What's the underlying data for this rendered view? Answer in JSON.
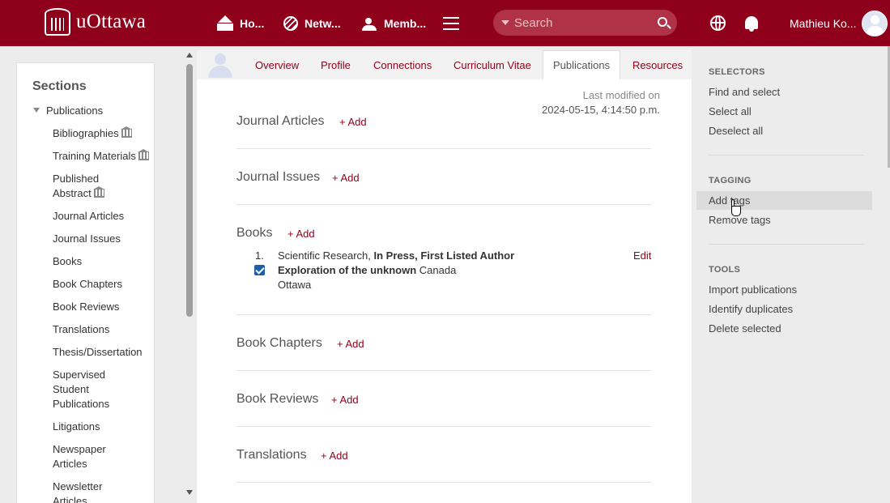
{
  "header": {
    "logo_text": "uOttawa",
    "nav": [
      {
        "label": "Ho..."
      },
      {
        "label": "Netw..."
      },
      {
        "label": "Memb..."
      }
    ],
    "search_placeholder": "Search",
    "user_name": "Mathieu Ko..."
  },
  "sidebar": {
    "title": "Sections",
    "root": "Publications",
    "items": [
      {
        "label": "Bibliographies"
      },
      {
        "label": "Training Materials"
      },
      {
        "label": "Published Abstract"
      },
      {
        "label": "Journal Articles"
      },
      {
        "label": "Journal Issues"
      },
      {
        "label": "Books"
      },
      {
        "label": "Book Chapters"
      },
      {
        "label": "Book Reviews"
      },
      {
        "label": "Translations"
      },
      {
        "label": "Thesis/Dissertation"
      },
      {
        "label": "Supervised Student Publications"
      },
      {
        "label": "Litigations"
      },
      {
        "label": "Newspaper Articles"
      },
      {
        "label": "Newsletter Articles"
      }
    ]
  },
  "tabs": [
    {
      "label": "Overview"
    },
    {
      "label": "Profile"
    },
    {
      "label": "Connections"
    },
    {
      "label": "Curriculum Vitae"
    },
    {
      "label": "Publications"
    },
    {
      "label": "Resources"
    }
  ],
  "main": {
    "last_modified_label": "Last modified on",
    "last_modified_date": "2024-05-15, 4:14:50 p.m.",
    "add_label": "+ Add",
    "sections": [
      {
        "title": "Journal Articles"
      },
      {
        "title": "Journal Issues"
      },
      {
        "title": "Books"
      },
      {
        "title": "Book Chapters"
      },
      {
        "title": "Book Reviews"
      },
      {
        "title": "Translations"
      }
    ],
    "book_entry": {
      "number": "1.",
      "publisher": "Scientific Research,",
      "status": "In Press",
      "role": "First Listed Author",
      "title": "Exploration of the unknown",
      "country": "Canada",
      "city": "Ottawa",
      "edit_label": "Edit"
    }
  },
  "right_panel": {
    "selectors_title": "SELECTORS",
    "selectors": [
      {
        "label": "Find and select"
      },
      {
        "label": "Select all"
      },
      {
        "label": "Deselect all"
      }
    ],
    "tagging_title": "TAGGING",
    "tagging": [
      {
        "label": "Add tags"
      },
      {
        "label": "Remove tags"
      }
    ],
    "tools_title": "TOOLS",
    "tools": [
      {
        "label": "Import publications"
      },
      {
        "label": "Identify duplicates"
      },
      {
        "label": "Delete selected"
      }
    ]
  }
}
